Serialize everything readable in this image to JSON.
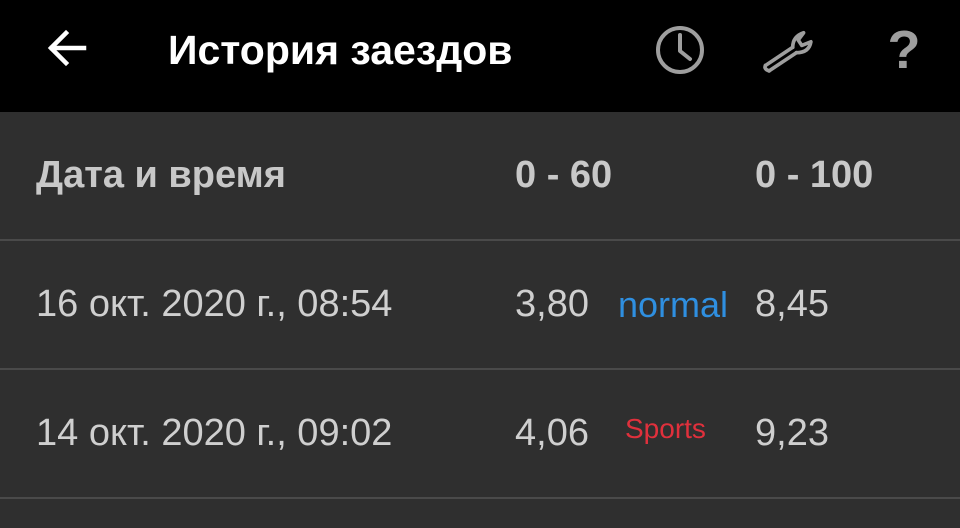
{
  "appbar": {
    "title": "История заездов",
    "back_icon": "arrow-back-icon",
    "actions": [
      {
        "icon": "clock-icon"
      },
      {
        "icon": "wrench-icon"
      },
      {
        "icon": "help-icon",
        "glyph": "?"
      }
    ]
  },
  "table": {
    "headers": {
      "date": "Дата и время",
      "t60": "0 - 60",
      "t100": "0 - 100"
    },
    "rows": [
      {
        "date": "16 окт. 2020 г., 08:54",
        "t60": "3,80",
        "mode": "normal",
        "mode_color": "#2f8fe0",
        "t100": "8,45"
      },
      {
        "date": "14 окт. 2020 г., 09:02",
        "t60": "4,06",
        "mode": "Sports",
        "mode_color": "#e0303c",
        "t100": "9,23"
      }
    ]
  },
  "colors": {
    "appbar_bg": "#000000",
    "content_bg": "#2f2f2f",
    "divider": "#4a4a4a",
    "icon_gray": "#9e9e9e",
    "text_primary": "#cfcfcf"
  }
}
